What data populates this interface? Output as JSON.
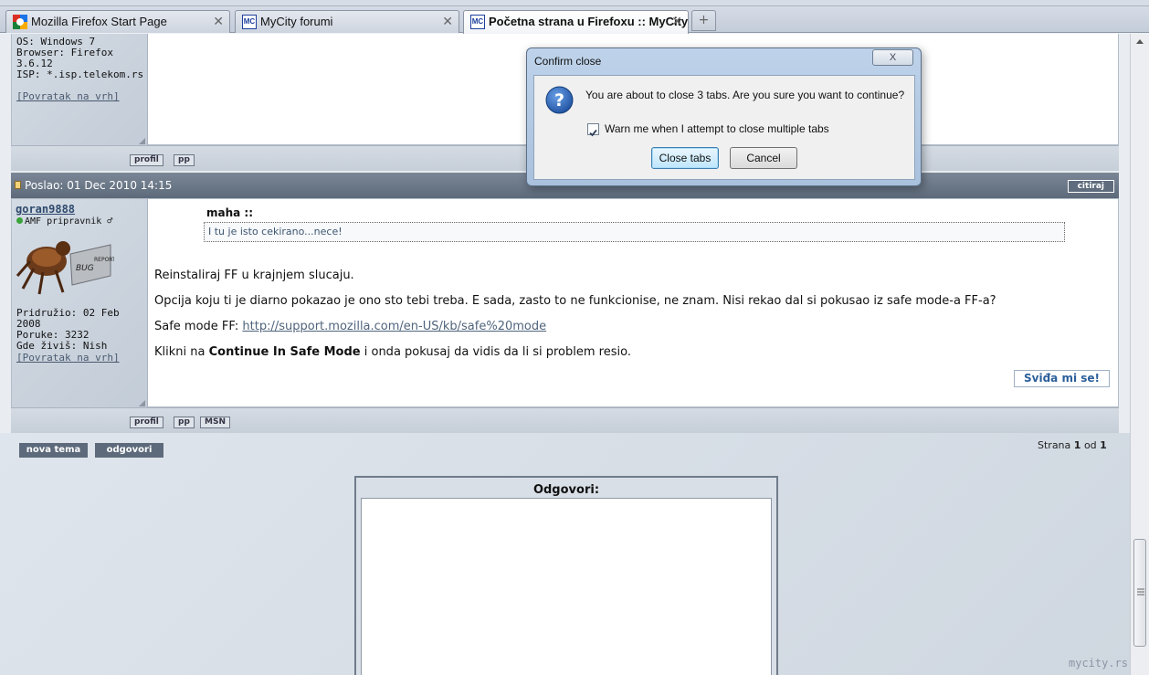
{
  "tabs": [
    {
      "label": "Mozilla Firefox Start Page",
      "icon": "google-favicon-icon"
    },
    {
      "label": "MyCity forumi",
      "icon": "mycity-favicon-icon"
    },
    {
      "label": "Početna strana u Firefoxu :: MyCity",
      "icon": "mycity-favicon-icon"
    }
  ],
  "tab_close_glyph": "✕",
  "new_tab_glyph": "+",
  "favicon_mc": "MC",
  "post1": {
    "info": "OS: Windows 7\nBrowser: Firefox\n3.6.12\nISP: *.isp.telekom.rs",
    "back_link": "[Povratak na vrh]",
    "buttons": [
      "profil",
      "pp"
    ]
  },
  "post2": {
    "header": "Poslao: 01 Dec 2010 14:15",
    "quote_button": "citiraj",
    "username": "goran9888",
    "rank": "AMF pripravnik ♂",
    "joined": "Pridružio: 02 Feb 2008",
    "posts": "Poruke: 3232",
    "location": "Gde živiš: Nish",
    "back_link": "[Povratak na vrh]",
    "quote_author": "maha ::",
    "quote_text": "I tu je isto cekirano...nece!",
    "para1": "Reinstaliraj FF u krajnjem slucaju.",
    "para2": "Opcija koju ti je diarno pokazao je ono sto tebi treba. E sada, zasto to ne funkcionise, ne znam. Nisi rekao dal si pokusao iz safe mode-a FF-a?",
    "safe_mode_label": "Safe mode FF:",
    "safe_mode_link": "http://support.mozilla.com/en-US/kb/safe%20mode",
    "para4_pre": "Klikni na",
    "para4_bold": "Continue In Safe Mode",
    "para4_post": "i onda pokusaj da vidis da li si problem resio.",
    "like_button": "Sviđa mi se!",
    "buttons": [
      "profil",
      "pp",
      "MSN"
    ]
  },
  "actions": {
    "new_topic": "nova tema",
    "reply": "odgovori"
  },
  "pagination": {
    "prefix": "Strana",
    "current": "1",
    "middle": "od",
    "total": "1"
  },
  "reply_box": {
    "title": "Odgovori:"
  },
  "watermark": "mycity.rs",
  "dialog": {
    "title": "Confirm close",
    "close_glyph": "X",
    "message": "You are about to close 3 tabs. Are you sure you want to continue?",
    "checkbox_label": "Warn me when I attempt to close multiple tabs",
    "checkbox_checked": true,
    "confirm_button": "Close tabs",
    "cancel_button": "Cancel"
  }
}
